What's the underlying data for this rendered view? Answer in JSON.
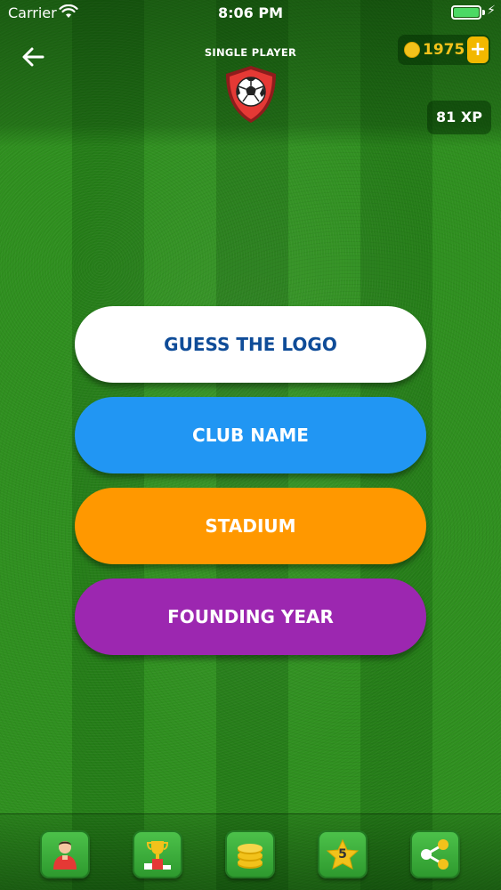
{
  "status_bar": {
    "carrier": "Carrier",
    "time": "8:06 PM"
  },
  "header": {
    "mode_title": "SINGLE PLAYER",
    "coins": "1975",
    "add_coins": "+",
    "xp": "81 XP"
  },
  "menu": {
    "items": [
      {
        "label": "GUESS THE LOGO",
        "color": "#ffffff",
        "text_color": "#0f4c98"
      },
      {
        "label": "CLUB NAME",
        "color": "#2196f3",
        "text_color": "#ffffff"
      },
      {
        "label": "STADIUM",
        "color": "#ff9800",
        "text_color": "#ffffff"
      },
      {
        "label": "FOUNDING YEAR",
        "color": "#9c27b0",
        "text_color": "#ffffff"
      }
    ]
  },
  "bottom_nav": {
    "items": [
      {
        "icon": "player-icon"
      },
      {
        "icon": "trophy-icon"
      },
      {
        "icon": "coins-icon"
      },
      {
        "icon": "star-icon",
        "badge": "5"
      },
      {
        "icon": "share-icon"
      }
    ]
  },
  "colors": {
    "grass_light": "#2f8f1f",
    "grass_dark": "#257d18",
    "coin": "#f2c21b",
    "nav_green": "#4cc14a"
  }
}
